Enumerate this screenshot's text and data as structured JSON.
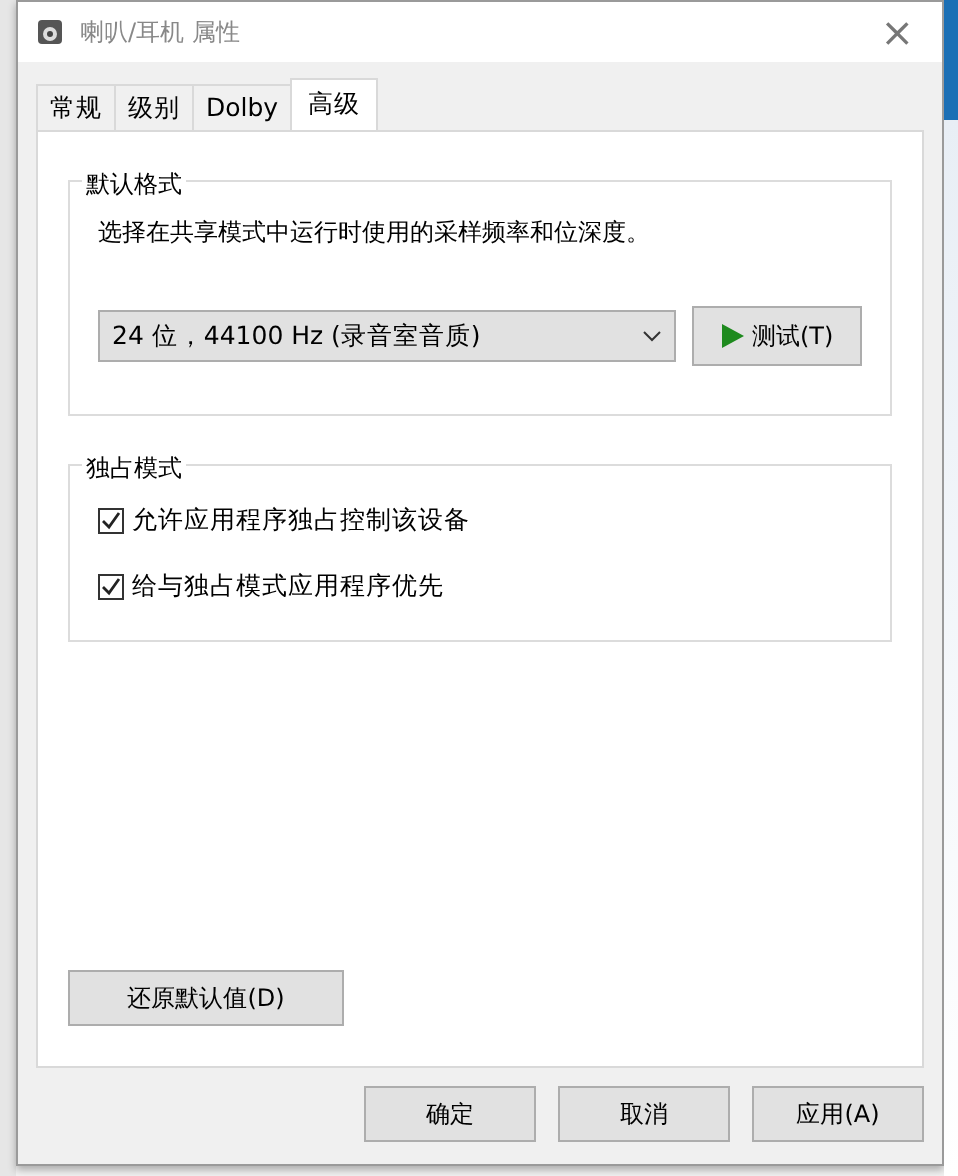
{
  "window": {
    "title": "喇叭/耳机 属性",
    "close": "×"
  },
  "tabs": [
    {
      "label": "常规",
      "selected": false
    },
    {
      "label": "级别",
      "selected": false
    },
    {
      "label": "Dolby",
      "selected": false
    },
    {
      "label": "高级",
      "selected": true
    }
  ],
  "default_format": {
    "title": "默认格式",
    "description": "选择在共享模式中运行时使用的采样频率和位深度。",
    "format": {
      "value": "24 位，44100 Hz (录音室音质)"
    },
    "test_button": "测试(T)"
  },
  "exclusive_mode": {
    "title": "独占模式",
    "options": [
      {
        "label": "允许应用程序独占控制该设备",
        "checked": true
      },
      {
        "label": "给与独占模式应用程序优先",
        "checked": true
      }
    ]
  },
  "restore_button": "还原默认值(D)",
  "buttons": [
    "确定",
    "取消",
    "应用(A)"
  ]
}
